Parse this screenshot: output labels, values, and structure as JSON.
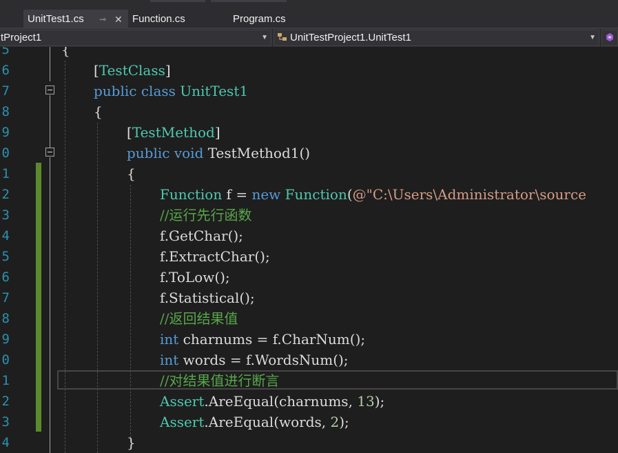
{
  "tabs": [
    {
      "label": "UnitTest1.cs",
      "pin": "⊸",
      "close": "✕"
    },
    {
      "label": "Function.cs"
    },
    {
      "label": "Program.cs"
    }
  ],
  "navbar": {
    "project": "tProject1",
    "class": "UnitTestProject1.UnitTest1",
    "dropdown_arrow": "▼"
  },
  "editor": {
    "line_numbers": [
      "5",
      "6",
      "7",
      "8",
      "9",
      "0",
      "1",
      "2",
      "3",
      "4",
      "5",
      "6",
      "7",
      "8",
      "9",
      "0",
      "1",
      "2",
      "3",
      "4"
    ],
    "lines": [
      [
        {
          "t": "{",
          "c": "pl"
        }
      ],
      [
        {
          "t": "[",
          "c": "pl"
        },
        {
          "t": "TestClass",
          "c": "ty"
        },
        {
          "t": "]",
          "c": "pl"
        }
      ],
      [
        {
          "t": "public",
          "c": "kw"
        },
        {
          "t": " ",
          "c": "pl"
        },
        {
          "t": "class",
          "c": "kw"
        },
        {
          "t": " ",
          "c": "pl"
        },
        {
          "t": "UnitTest1",
          "c": "ty"
        }
      ],
      [
        {
          "t": "{",
          "c": "pl"
        }
      ],
      [
        {
          "t": "[",
          "c": "pl"
        },
        {
          "t": "TestMethod",
          "c": "ty"
        },
        {
          "t": "]",
          "c": "pl"
        }
      ],
      [
        {
          "t": "public",
          "c": "kw"
        },
        {
          "t": " ",
          "c": "pl"
        },
        {
          "t": "void",
          "c": "kw"
        },
        {
          "t": " TestMethod1()",
          "c": "pl"
        }
      ],
      [
        {
          "t": "{",
          "c": "pl"
        }
      ],
      [
        {
          "t": "Function",
          "c": "ty"
        },
        {
          "t": " f = ",
          "c": "pl"
        },
        {
          "t": "new",
          "c": "kw"
        },
        {
          "t": " ",
          "c": "pl"
        },
        {
          "t": "Function",
          "c": "ty"
        },
        {
          "t": "(",
          "c": "pl"
        },
        {
          "t": "@\"C:\\Users\\Administrator\\source",
          "c": "st"
        }
      ],
      [
        {
          "t": "//运行先行函数",
          "c": "cm"
        }
      ],
      [
        {
          "t": "f.GetChar();",
          "c": "pl"
        }
      ],
      [
        {
          "t": "f.ExtractChar();",
          "c": "pl"
        }
      ],
      [
        {
          "t": "f.ToLow();",
          "c": "pl"
        }
      ],
      [
        {
          "t": "f.Statistical();",
          "c": "pl"
        }
      ],
      [
        {
          "t": "//返回结果值",
          "c": "cm"
        }
      ],
      [
        {
          "t": "int",
          "c": "kw"
        },
        {
          "t": " charnums = f.CharNum();",
          "c": "pl"
        }
      ],
      [
        {
          "t": "int",
          "c": "kw"
        },
        {
          "t": " words = f.WordsNum();",
          "c": "pl"
        }
      ],
      [
        {
          "t": "//对结果值进行断言",
          "c": "cm"
        }
      ],
      [
        {
          "t": "Assert",
          "c": "ty"
        },
        {
          "t": ".AreEqual(charnums, ",
          "c": "pl"
        },
        {
          "t": "13",
          "c": "nm"
        },
        {
          "t": ");",
          "c": "pl"
        }
      ],
      [
        {
          "t": "Assert",
          "c": "ty"
        },
        {
          "t": ".AreEqual(words, ",
          "c": "pl"
        },
        {
          "t": "2",
          "c": "nm"
        },
        {
          "t": ");",
          "c": "pl"
        }
      ],
      [
        {
          "t": "}",
          "c": "pl"
        }
      ]
    ]
  }
}
